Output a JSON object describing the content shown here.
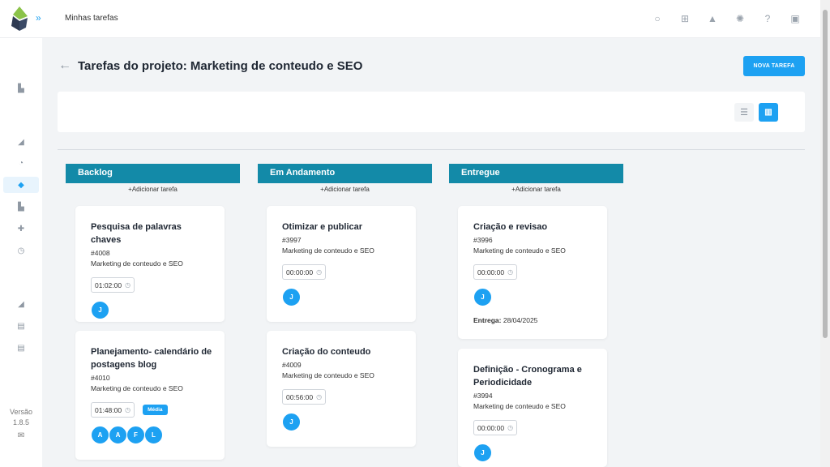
{
  "header": {
    "breadcrumb": "Minhas tarefas",
    "icons": [
      "search-icon",
      "plus-square-icon",
      "bell-icon",
      "sun-icon",
      "help-icon",
      "profile-image-icon"
    ]
  },
  "sidebar": {
    "icons": [
      "dashboard-icon",
      "chart-icon",
      "pie-icon",
      "projects-icon",
      "report-icon",
      "pin-icon",
      "clock-icon",
      "chart-icon-2",
      "document-icon",
      "document-icon-2"
    ],
    "version_label": "Versão",
    "version_number": "1.8.5"
  },
  "page": {
    "title": "Tarefas do projeto: Marketing de conteudo e SEO",
    "new_task_label": "NOVA TAREFA"
  },
  "columns": [
    {
      "title": "Backlog",
      "add_label": "Adicionar tarefa",
      "cards": [
        {
          "title": "Pesquisa de palavras chaves",
          "id": "#4008",
          "project": "Marketing de conteudo e SEO",
          "time": "01:02:00",
          "avatars": [
            "J"
          ]
        },
        {
          "title": "Planejamento- calendário de postagens blog",
          "id": "#4010",
          "project": "Marketing de conteudo e SEO",
          "time": "01:48:00",
          "priority": "Média",
          "avatars": [
            "A",
            "A",
            "F",
            "L"
          ]
        }
      ]
    },
    {
      "title": "Em Andamento",
      "add_label": "Adicionar tarefa",
      "cards": [
        {
          "title": "Otimizar e publicar",
          "id": "#3997",
          "project": "Marketing de conteudo e SEO",
          "time": "00:00:00",
          "avatars": [
            "J"
          ]
        },
        {
          "title": "Criação do conteudo",
          "id": "#4009",
          "project": "Marketing de conteudo e SEO",
          "time": "00:56:00",
          "avatars": [
            "J"
          ]
        }
      ]
    },
    {
      "title": "Entregue",
      "add_label": "Adicionar tarefa",
      "cards": [
        {
          "title": "Criação e revisao",
          "id": "#3996",
          "project": "Marketing de conteudo e SEO",
          "time": "00:00:00",
          "avatars": [
            "J"
          ],
          "delivery_label": "Entrega:",
          "delivery_date": "28/04/2025"
        },
        {
          "title": "Definição - Cronograma e Periodicidade",
          "id": "#3994",
          "project": "Marketing de conteudo e SEO",
          "time": "00:00:00",
          "avatars": [
            "J"
          ]
        }
      ]
    }
  ],
  "colors": {
    "accent": "#1da1f2",
    "column_header": "#138aa8"
  }
}
